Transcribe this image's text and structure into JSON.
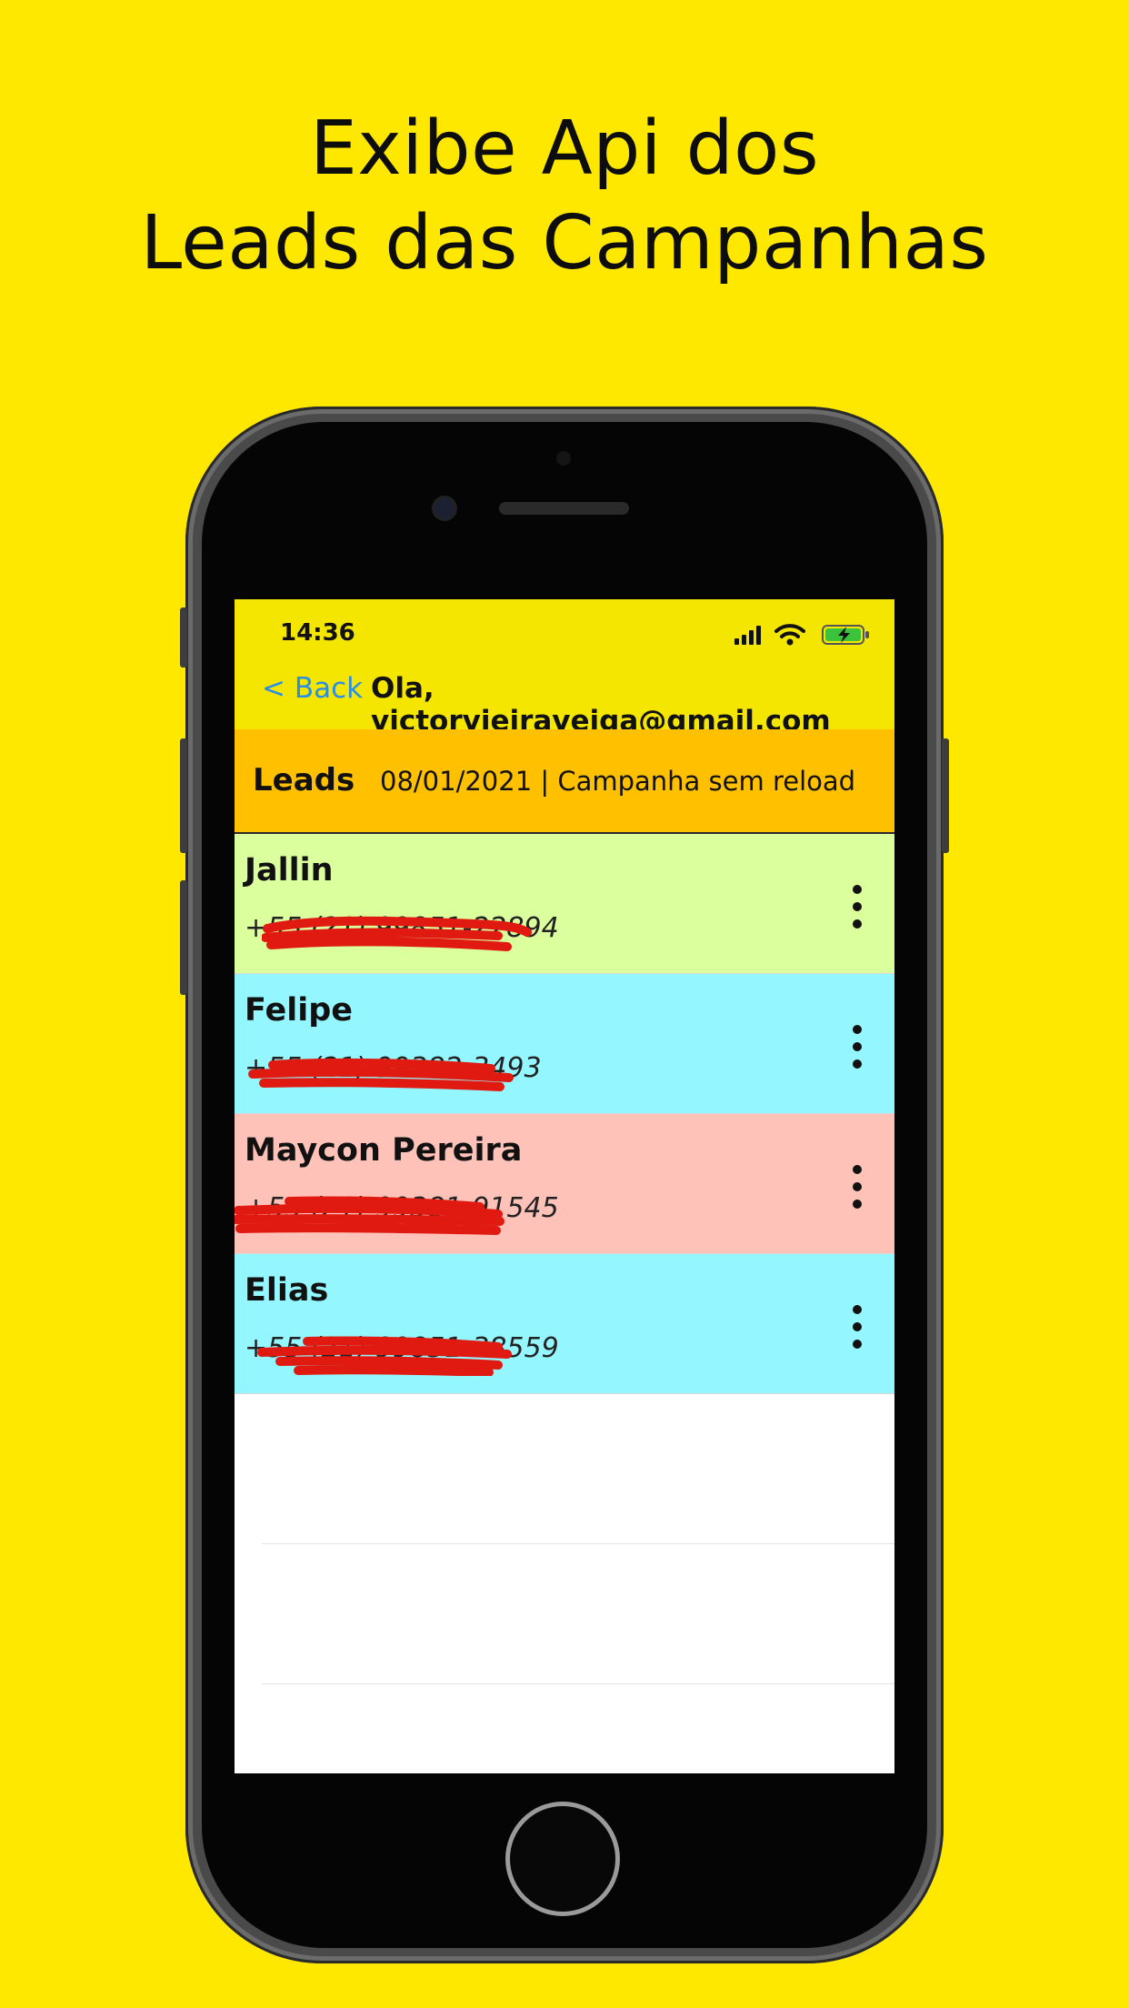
{
  "headline": {
    "line1": "Exibe Api dos",
    "line2": "Leads das Campanhas"
  },
  "status_bar": {
    "time": "14:36"
  },
  "nav": {
    "back_label": "< Back",
    "greeting": "Ola, victorvieiraveiga@gmail.com"
  },
  "header": {
    "title": "Leads",
    "subtitle": "08/01/2021 | Campanha sem reload"
  },
  "leads": [
    {
      "name": "Jallin",
      "phone": "+55 (21) 99851-22894",
      "color": "#dcff9e"
    },
    {
      "name": "Felipe",
      "phone": "+55 (21) 99382-3493",
      "color": "#94f7ff"
    },
    {
      "name": "Maycon Pereira",
      "phone": "+55 (21) 99381-91545",
      "color": "#ffc2b8"
    },
    {
      "name": "Elias",
      "phone": "+55 (21) 99851-38559",
      "color": "#94f7ff"
    }
  ],
  "colors": {
    "background": "#ffe800",
    "topbar": "#f5e600",
    "header": "#ffc000",
    "back": "#2a8ee6",
    "redaction": "#e01a10"
  }
}
